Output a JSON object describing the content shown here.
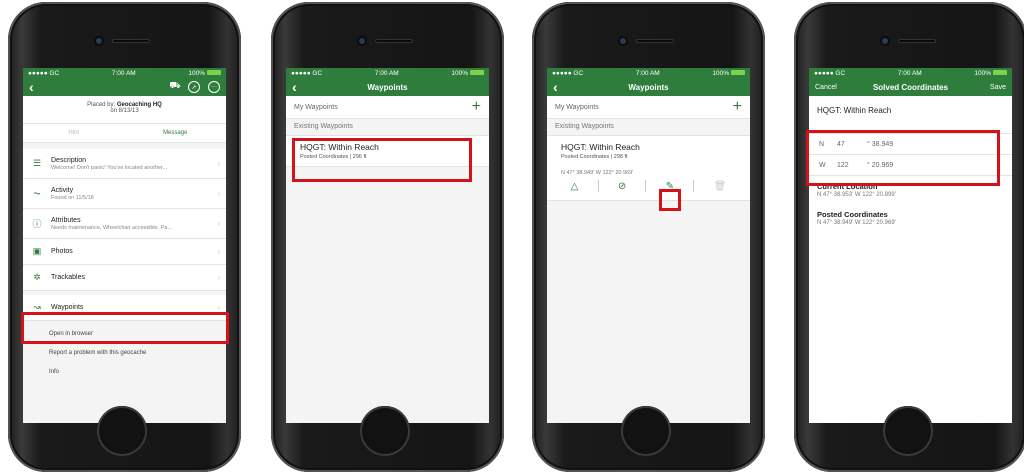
{
  "status": {
    "carrier": "●●●●● GC ",
    "time": "7:00 AM",
    "battery": "100%"
  },
  "screen1": {
    "placed_by_prefix": "Placed by: ",
    "placed_by_name": "Geocaching HQ",
    "placed_on": "on 8/13/13",
    "tab_hint": "Hint",
    "tab_message": "Message",
    "rows": [
      {
        "icon": "description-icon",
        "glyph": "☰",
        "title": "Description",
        "sub": "Welcome! Don't panic! You've located another..."
      },
      {
        "icon": "activity-icon",
        "glyph": "⏦",
        "title": "Activity",
        "sub": "Found on 11/5/18"
      },
      {
        "icon": "attributes-icon",
        "glyph": "ⓘ",
        "title": "Attributes",
        "sub": "Needs maintenance, Wheelchair accessible, Pa..."
      },
      {
        "icon": "photos-icon",
        "glyph": "▣",
        "title": "Photos",
        "sub": ""
      },
      {
        "icon": "trackables-icon",
        "glyph": "✲",
        "title": "Trackables",
        "sub": ""
      },
      {
        "icon": "waypoints-icon",
        "glyph": "↝",
        "title": "Waypoints",
        "sub": ""
      }
    ],
    "sub_items": [
      "Open in browser",
      "Report a problem with this geocache",
      "Info"
    ]
  },
  "screen2": {
    "title": "Waypoints",
    "my_waypoints": "My Waypoints",
    "existing": "Existing Waypoints",
    "wp_name": "HQGT: Within Reach",
    "wp_sub": "Posted Coordinates | 296 ft"
  },
  "screen3": {
    "title": "Waypoints",
    "my_waypoints": "My Waypoints",
    "existing": "Existing Waypoints",
    "wp_name": "HQGT: Within Reach",
    "wp_sub": "Posted Coordinates | 298 ft",
    "coords": "N 47° 38.949'  W 122° 20.969'"
  },
  "screen4": {
    "cancel": "Cancel",
    "title": "Solved Coordinates",
    "save": "Save",
    "cache_name": "HQGT: Within Reach",
    "n_label": "N",
    "n_deg": "47",
    "n_min": "° 38.949",
    "w_label": "W",
    "w_deg": "122",
    "w_min": "° 20.969",
    "current_label": "Current Location",
    "current_value": "N 47° 38.953'  W 122° 20.899'",
    "posted_label": "Posted Coordinates",
    "posted_value": "N 47° 38.949'  W 122° 20.969'"
  },
  "colors": {
    "brand_green": "#2f7d3d",
    "highlight_red": "#d4121a"
  }
}
